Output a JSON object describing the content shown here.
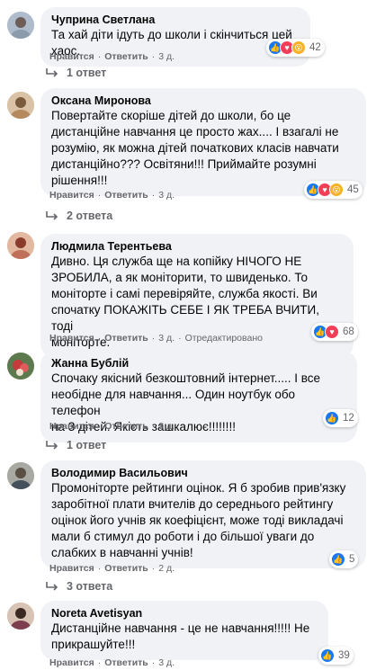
{
  "comments": [
    {
      "author": "Чуприна Светлана",
      "text": "Та хай діти ідуть до школи і скінчиться цей хаос.",
      "actions": {
        "like": "Нравится",
        "reply": "Ответить",
        "time": "3 д."
      },
      "reactions": {
        "types": [
          "like",
          "love",
          "wow"
        ],
        "count": "42"
      },
      "replies_label": "1 ответ"
    },
    {
      "author": "Оксана Миронова",
      "text": "Повертайте скоріше дітей до школи, бо це\nдистанційне навчання це просто жах.... І взагалі не\nрозумію, як можна дітей початкових класів навчати\nдистанційно??? Освітяни!!! Приймайте розумні\nрішення!!!",
      "actions": {
        "like": "Нравится",
        "reply": "Ответить",
        "time": "3 д."
      },
      "reactions": {
        "types": [
          "like",
          "love",
          "wow"
        ],
        "count": "45"
      },
      "replies_label": "2 ответа"
    },
    {
      "author": "Людмила Терентьева",
      "text": "Дивно. Ця служба ще на копійку НІЧОГО НЕ\nЗРОБИЛА, а як моніторити, то швиденько. То\nмоніторте і самі перевіряйте, служба якості. Ви\nспочатку ПОКАЖІТЬ СЕБЕ І ЯК ТРЕБА ВЧИТИ, тоді\nмоніторте.",
      "actions": {
        "like": "Нравится",
        "reply": "Ответить",
        "time": "3 д.",
        "edited": "Отредактировано"
      },
      "reactions": {
        "types": [
          "like",
          "love"
        ],
        "count": "68"
      },
      "replies_label": ""
    },
    {
      "author": "Жанна Бублій",
      "text": "Спочаку якісний безкоштовний інтернет..... І все\nнеобідне для навчання... Один ноутбук обо телефон\nна 3 дітей. Якість зашкалює!!!!!!!!",
      "actions": {
        "like": "Нравится",
        "reply": "Ответить",
        "time": "3 д."
      },
      "reactions": {
        "types": [
          "like"
        ],
        "count": "12"
      },
      "replies_label": "1 ответ"
    },
    {
      "author": "Володимир Васильович",
      "text": "Промоніторте рейтинги оцінок. Я б зробив прив'язку\nзаробітної плати вчителів до середнього рейтингу\nоцінок його учнів як коефіцієнт, може тоді викладачі\nмали б стимул до роботи і до більшої уваги до\nслабких в навчанні учнів!",
      "actions": {
        "like": "Нравится",
        "reply": "Ответить",
        "time": "2 д."
      },
      "reactions": {
        "types": [
          "like"
        ],
        "count": "5"
      },
      "replies_label": "3 ответа"
    },
    {
      "author": "Noreta Avetisyan",
      "text": "Дистанційне навчання - це не навчання!!!!! Не\nприкрашуйте!!!",
      "actions": {
        "like": "Нравится",
        "reply": "Ответить",
        "time": "3 д."
      },
      "reactions": {
        "types": [
          "like"
        ],
        "count": "39"
      },
      "replies_label": ""
    }
  ],
  "colors": {
    "like": "#1877f2",
    "love": "#f33e58",
    "wow": "#f7b125",
    "bubble": "#f0f2f5",
    "meta": "#65676b"
  }
}
